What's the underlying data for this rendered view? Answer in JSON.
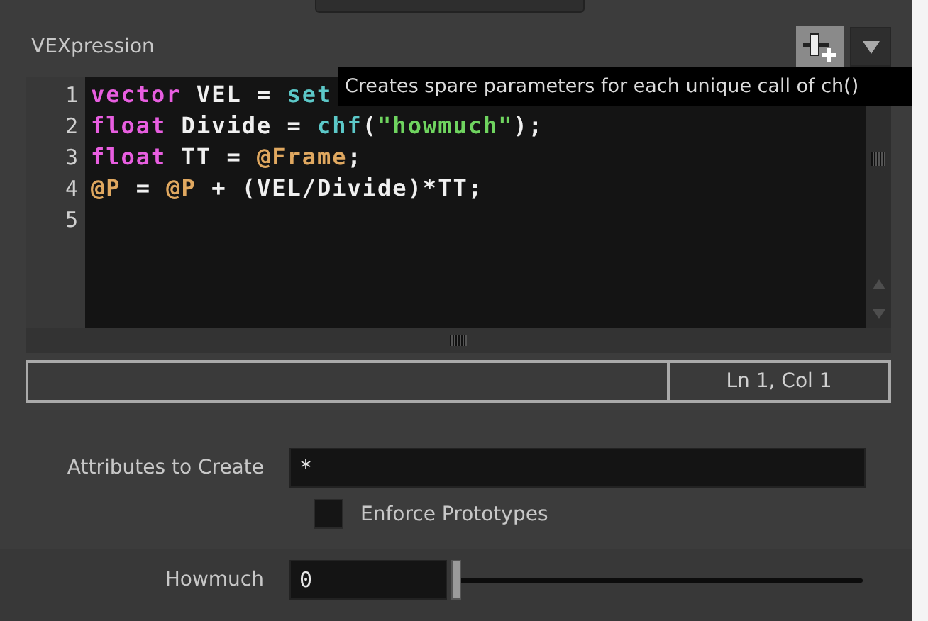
{
  "vexpression": {
    "label": "VEXpression",
    "tooltip": "Creates spare parameters for each unique call of ch()",
    "lines": [
      {
        "number": "1",
        "tokens": [
          {
            "kind": "keyword",
            "text": "vector"
          },
          {
            "kind": "plain",
            "text": " VEL = "
          },
          {
            "kind": "function",
            "text": "set"
          }
        ]
      },
      {
        "number": "2",
        "tokens": [
          {
            "kind": "keyword",
            "text": "float"
          },
          {
            "kind": "plain",
            "text": " Divide = "
          },
          {
            "kind": "function",
            "text": "chf"
          },
          {
            "kind": "plain",
            "text": "("
          },
          {
            "kind": "string",
            "text": "\"howmuch\""
          },
          {
            "kind": "plain",
            "text": ");"
          }
        ]
      },
      {
        "number": "3",
        "tokens": [
          {
            "kind": "keyword",
            "text": "float"
          },
          {
            "kind": "plain",
            "text": " TT = "
          },
          {
            "kind": "attribute",
            "text": "@Frame"
          },
          {
            "kind": "plain",
            "text": ";"
          }
        ]
      },
      {
        "number": "4",
        "tokens": [
          {
            "kind": "attribute",
            "text": "@P"
          },
          {
            "kind": "plain",
            "text": " = "
          },
          {
            "kind": "attribute",
            "text": "@P"
          },
          {
            "kind": "plain",
            "text": " + (VEL/Divide)*TT;"
          }
        ]
      },
      {
        "number": "5"
      }
    ],
    "status_position": "Ln 1, Col 1"
  },
  "attributes_to_create": {
    "label": "Attributes to Create",
    "value": "*"
  },
  "enforce_prototypes": {
    "label": "Enforce Prototypes",
    "checked": false
  },
  "howmuch": {
    "label": "Howmuch",
    "value": "0",
    "level": 0
  }
}
